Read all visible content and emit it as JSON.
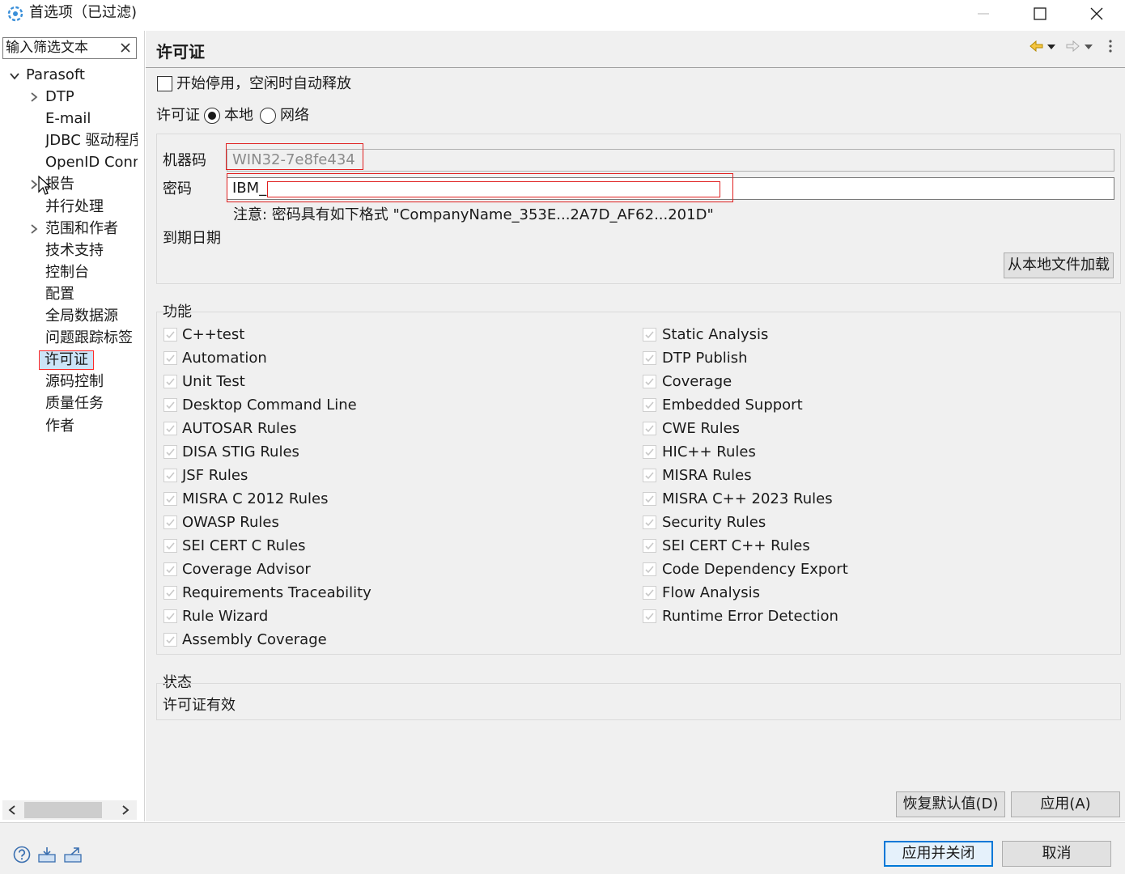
{
  "window": {
    "title": "首选项（已过滤)",
    "icon": "eclipse-gear-icon"
  },
  "filter": {
    "value": "输入筛选文本",
    "clear_icon": "clear-x-icon"
  },
  "tree": {
    "root": "Parasoft",
    "items": [
      {
        "label": "DTP",
        "expandable": true
      },
      {
        "label": "E-mail",
        "expandable": false
      },
      {
        "label": "JDBC 驱动程序",
        "expandable": false
      },
      {
        "label": "OpenID Connect",
        "expandable": false
      },
      {
        "label": "报告",
        "expandable": true
      },
      {
        "label": "并行处理",
        "expandable": false
      },
      {
        "label": "范围和作者",
        "expandable": true
      },
      {
        "label": "技术支持",
        "expandable": false
      },
      {
        "label": "控制台",
        "expandable": false
      },
      {
        "label": "配置",
        "expandable": false
      },
      {
        "label": "全局数据源",
        "expandable": false
      },
      {
        "label": "问题跟踪标签",
        "expandable": false
      },
      {
        "label": "许可证",
        "expandable": false,
        "selected": true
      },
      {
        "label": "源码控制",
        "expandable": false
      },
      {
        "label": "质量任务",
        "expandable": false
      },
      {
        "label": "作者",
        "expandable": false
      }
    ]
  },
  "page": {
    "title": "许可证",
    "start_disabled_label": "开始停用，空闲时自动释放",
    "license_label": "许可证",
    "radio_local": "本地",
    "radio_network": "网络",
    "selected_radio": "local",
    "machine_code_label": "机器码",
    "machine_code_value": "WIN32-7e8fe434",
    "password_label": "密码",
    "password_value": "IBM_",
    "note": "注意: 密码具有如下格式 \"CompanyName_353E...2A7D_AF62...201D\"",
    "expiry_label": "到期日期",
    "load_button": "从本地文件加载",
    "features_label": "功能",
    "features_left": [
      "C++test",
      "Automation",
      "Unit Test",
      "Desktop Command Line",
      "AUTOSAR Rules",
      "DISA STIG Rules",
      "JSF Rules",
      "MISRA C 2012 Rules",
      "OWASP Rules",
      "SEI CERT C Rules",
      "Coverage Advisor",
      "Requirements Traceability",
      "Rule Wizard",
      "Assembly Coverage"
    ],
    "features_right": [
      "Static Analysis",
      "DTP Publish",
      "Coverage",
      "Embedded Support",
      "CWE Rules",
      "HIC++ Rules",
      "MISRA Rules",
      "MISRA C++ 2023 Rules",
      "Security Rules",
      "SEI CERT C++ Rules",
      "Code Dependency Export",
      "Flow Analysis",
      "Runtime Error Detection"
    ],
    "status_label": "状态",
    "status_value": "许可证有效",
    "restore_button": "恢复默认值(D)",
    "apply_button": "应用(A)"
  },
  "footer": {
    "apply_close_button": "应用并关闭",
    "cancel_button": "取消",
    "icons": [
      "help-icon",
      "import-icon",
      "export-icon"
    ]
  },
  "colors": {
    "accent": "#0078d7",
    "selection": "#cce4f7",
    "highlight_box": "#e02020",
    "pane_bg": "#f0f0f0"
  }
}
